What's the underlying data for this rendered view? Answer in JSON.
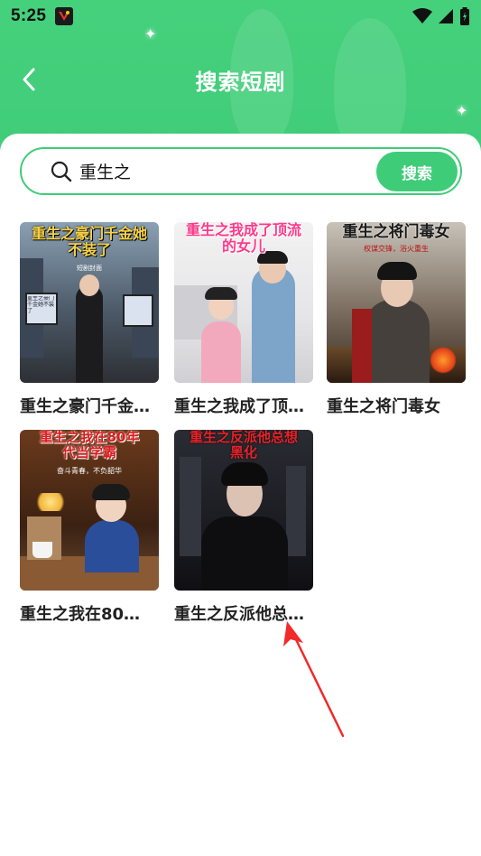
{
  "status_bar": {
    "time": "5:25"
  },
  "header": {
    "title": "搜索短剧"
  },
  "search": {
    "value": "重生之",
    "button_label": "搜索"
  },
  "results": [
    {
      "label": "重生之豪门千金…",
      "cover_title": "重生之豪门千金她不装了",
      "cover_sub": "短剧封面",
      "sign_text": "重生之豪门千金她不装了"
    },
    {
      "label": "重生之我成了顶…",
      "cover_title": "重生之我成了顶流的女儿"
    },
    {
      "label": "重生之将门毒女",
      "cover_title": "重生之将门毒女",
      "cover_sub": "权谋交锋，浴火重生"
    },
    {
      "label": "重生之我在80…",
      "cover_title": "重生之我在80年代当学霸",
      "cover_sub": "奋斗青春，不负韶华"
    },
    {
      "label": "重生之反派他总…",
      "cover_title": "重生之反派他总想黑化"
    }
  ],
  "colors": {
    "accent": "#3fcc78",
    "annotation_arrow": "#f22a2a"
  }
}
